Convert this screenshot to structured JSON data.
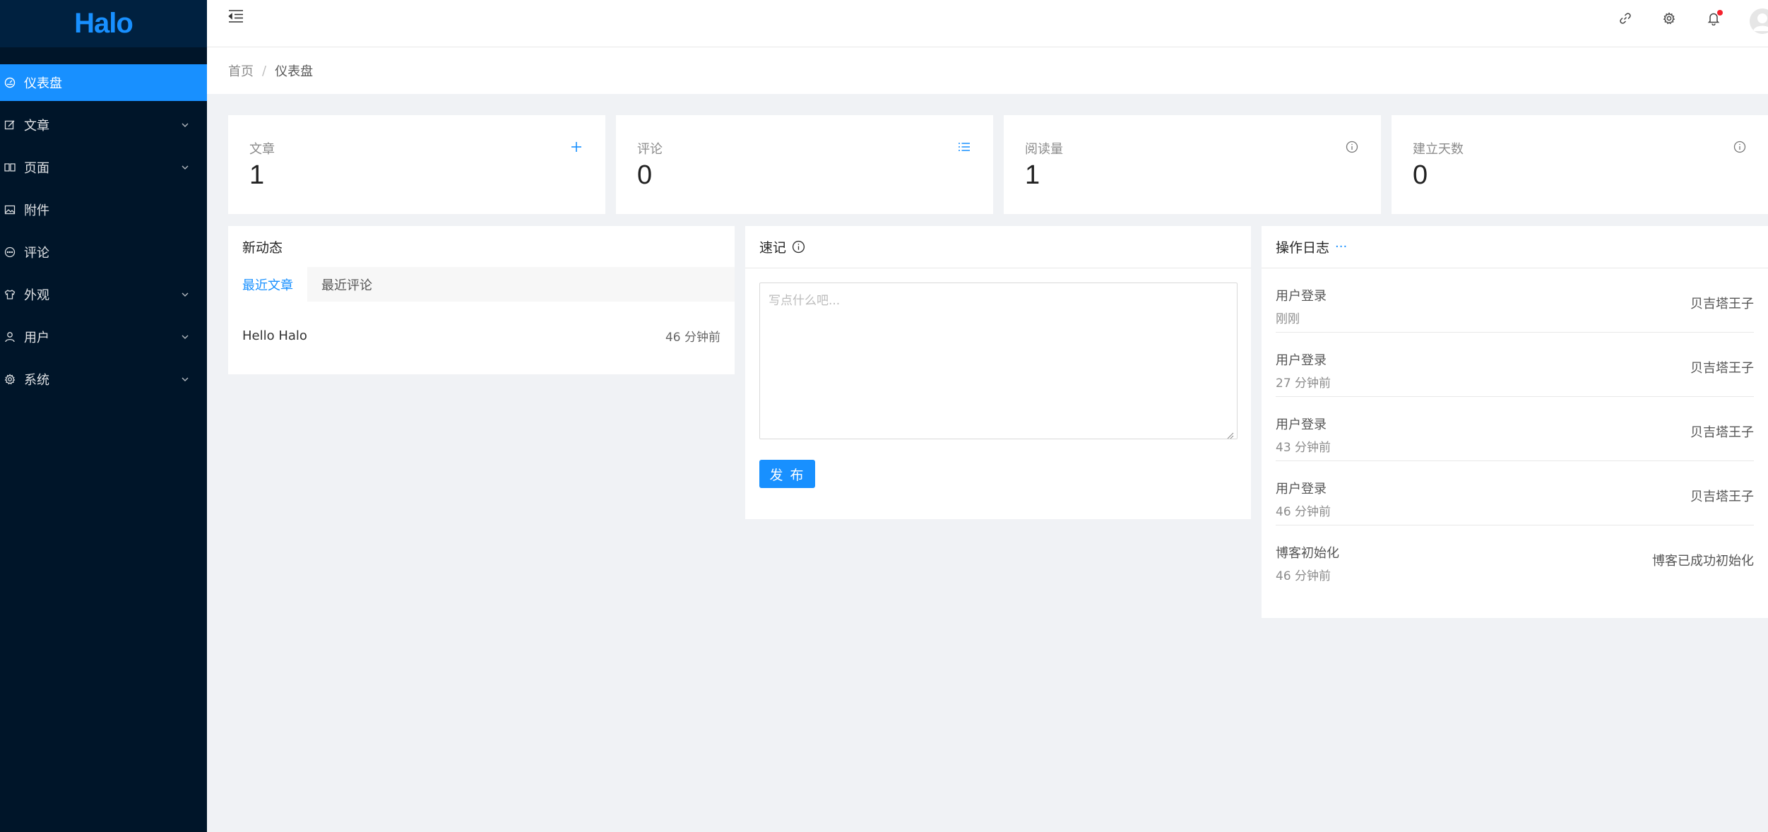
{
  "app": {
    "logo": "Halo"
  },
  "sidebar": {
    "items": [
      {
        "label": "仪表盘",
        "icon": "dashboard-icon",
        "active": true,
        "has_children": false
      },
      {
        "label": "文章",
        "icon": "edit-icon",
        "active": false,
        "has_children": true
      },
      {
        "label": "页面",
        "icon": "read-icon",
        "active": false,
        "has_children": true
      },
      {
        "label": "附件",
        "icon": "picture-icon",
        "active": false,
        "has_children": false
      },
      {
        "label": "评论",
        "icon": "message-icon",
        "active": false,
        "has_children": false
      },
      {
        "label": "外观",
        "icon": "skin-icon",
        "active": false,
        "has_children": true
      },
      {
        "label": "用户",
        "icon": "user-icon",
        "active": false,
        "has_children": true
      },
      {
        "label": "系统",
        "icon": "setting-icon",
        "active": false,
        "has_children": true
      }
    ]
  },
  "header": {
    "icons": [
      "menu-fold-icon",
      "link-icon",
      "gear-icon",
      "bell-icon",
      "avatar"
    ],
    "notification_dot": true
  },
  "breadcrumb": {
    "home": "首页",
    "separator": "/",
    "current": "仪表盘"
  },
  "stats": [
    {
      "label": "文章",
      "value": "1",
      "icon": "plus-icon"
    },
    {
      "label": "评论",
      "value": "0",
      "icon": "list-icon"
    },
    {
      "label": "阅读量",
      "value": "1",
      "icon": "info-icon"
    },
    {
      "label": "建立天数",
      "value": "0",
      "icon": "info-icon"
    }
  ],
  "activity": {
    "title": "新动态",
    "tabs": [
      {
        "label": "最近文章",
        "active": true
      },
      {
        "label": "最近评论",
        "active": false
      }
    ],
    "posts": [
      {
        "title": "Hello Halo",
        "time": "46 分钟前"
      }
    ]
  },
  "memo": {
    "title": "速记",
    "placeholder": "写点什么吧...",
    "publish_label": "发 布"
  },
  "oplog": {
    "title": "操作日志",
    "more": "···",
    "entries": [
      {
        "type": "用户登录",
        "time": "刚刚",
        "content": "贝吉塔王子"
      },
      {
        "type": "用户登录",
        "time": "27 分钟前",
        "content": "贝吉塔王子"
      },
      {
        "type": "用户登录",
        "time": "43 分钟前",
        "content": "贝吉塔王子"
      },
      {
        "type": "用户登录",
        "time": "46 分钟前",
        "content": "贝吉塔王子"
      },
      {
        "type": "博客初始化",
        "time": "46 分钟前",
        "content": "博客已成功初始化"
      }
    ]
  },
  "colors": {
    "primary": "#1890ff",
    "sidebar_bg": "#001529",
    "logo_bg": "#002140",
    "page_bg": "#f0f2f5",
    "badge": "#f5222d"
  }
}
